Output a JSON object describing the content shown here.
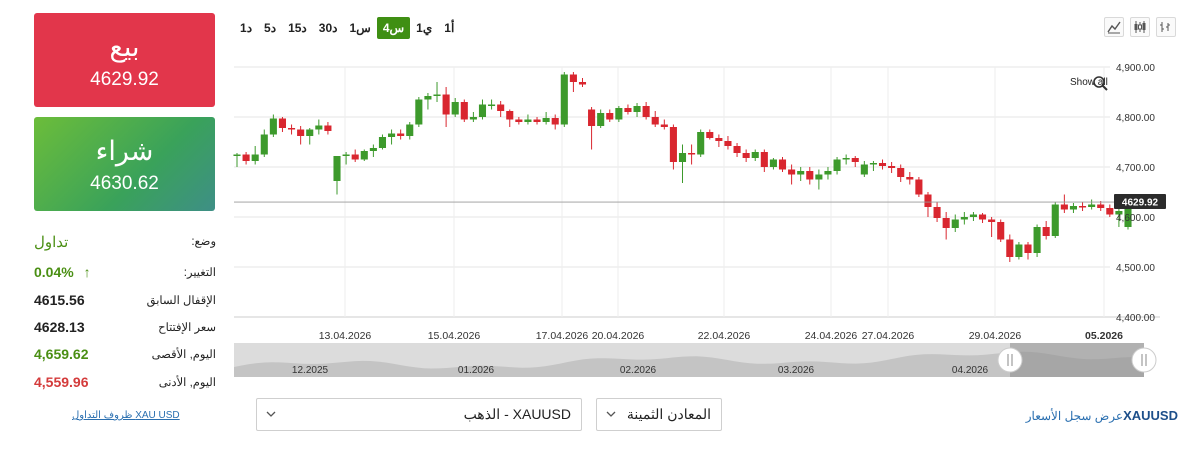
{
  "sell": {
    "label": "بيع",
    "price": "4629.92"
  },
  "buy": {
    "label": "شراء",
    "price": "4630.62"
  },
  "info": {
    "status_label": "وضع:",
    "status_value": "تداول",
    "change_label": "التغيير:",
    "change_value": "0.04%",
    "prev_close_label": "الإقفال السابق",
    "prev_close_value": "4615.56",
    "open_label": "سعر الإفتتاح",
    "open_value": "4628.13",
    "high_label": "اليوم, الأقصى",
    "high_value": "4,659.62",
    "low_label": "اليوم, الأدنى",
    "low_value": "4,559.96"
  },
  "terms_link": "XAU USD ظروف التداول",
  "timeframes": [
    "1أ",
    "1ي",
    "4س",
    "1س",
    "30د",
    "15د",
    "5د",
    "1د"
  ],
  "active_timeframe": "4س",
  "chart_tools": [
    "line-chart-icon",
    "candlestick-icon",
    "bar-chart-icon"
  ],
  "show_all_label": "Show all",
  "current_price_tag": "4629.92",
  "chart_data": {
    "type": "candlestick",
    "y_ticks": [
      "4,900.00",
      "4,800.00",
      "4,700.00",
      "4,600.00",
      "4,500.00",
      "4,400.00"
    ],
    "ylim": [
      4400,
      4900
    ],
    "x_ticks": [
      "13.04.2026",
      "15.04.2026",
      "17.04.2026",
      "20.04.2026",
      "22.04.2026",
      "24.04.2026",
      "27.04.2026",
      "29.04.2026",
      "05.2026"
    ],
    "navigator_ticks": [
      "12.2025",
      "01.2026",
      "02.2026",
      "03.2026",
      "04.2026"
    ],
    "colors": {
      "up": "#3d9a2c",
      "down": "#d9262f"
    },
    "candles": [
      {
        "o": 4722,
        "h": 4728,
        "l": 4700,
        "c": 4725
      },
      {
        "o": 4725,
        "h": 4730,
        "l": 4705,
        "c": 4712
      },
      {
        "o": 4712,
        "h": 4742,
        "l": 4705,
        "c": 4725
      },
      {
        "o": 4725,
        "h": 4775,
        "l": 4720,
        "c": 4765
      },
      {
        "o": 4765,
        "h": 4805,
        "l": 4760,
        "c": 4797
      },
      {
        "o": 4797,
        "h": 4800,
        "l": 4770,
        "c": 4778
      },
      {
        "o": 4778,
        "h": 4785,
        "l": 4765,
        "c": 4775
      },
      {
        "o": 4775,
        "h": 4782,
        "l": 4745,
        "c": 4762
      },
      {
        "o": 4762,
        "h": 4778,
        "l": 4745,
        "c": 4775
      },
      {
        "o": 4775,
        "h": 4795,
        "l": 4765,
        "c": 4783
      },
      {
        "o": 4783,
        "h": 4790,
        "l": 4765,
        "c": 4772
      },
      {
        "o": 4672,
        "h": 4700,
        "l": 4645,
        "c": 4722
      },
      {
        "o": 4722,
        "h": 4730,
        "l": 4705,
        "c": 4725
      },
      {
        "o": 4725,
        "h": 4735,
        "l": 4710,
        "c": 4715
      },
      {
        "o": 4715,
        "h": 4735,
        "l": 4712,
        "c": 4732
      },
      {
        "o": 4732,
        "h": 4745,
        "l": 4720,
        "c": 4738
      },
      {
        "o": 4738,
        "h": 4765,
        "l": 4735,
        "c": 4760
      },
      {
        "o": 4760,
        "h": 4775,
        "l": 4745,
        "c": 4767
      },
      {
        "o": 4767,
        "h": 4775,
        "l": 4755,
        "c": 4762
      },
      {
        "o": 4762,
        "h": 4790,
        "l": 4755,
        "c": 4785
      },
      {
        "o": 4785,
        "h": 4840,
        "l": 4780,
        "c": 4835
      },
      {
        "o": 4835,
        "h": 4848,
        "l": 4815,
        "c": 4842
      },
      {
        "o": 4842,
        "h": 4870,
        "l": 4830,
        "c": 4845
      },
      {
        "o": 4845,
        "h": 4860,
        "l": 4780,
        "c": 4805
      },
      {
        "o": 4805,
        "h": 4838,
        "l": 4800,
        "c": 4830
      },
      {
        "o": 4830,
        "h": 4835,
        "l": 4790,
        "c": 4795
      },
      {
        "o": 4795,
        "h": 4810,
        "l": 4790,
        "c": 4800
      },
      {
        "o": 4800,
        "h": 4835,
        "l": 4795,
        "c": 4825
      },
      {
        "o": 4825,
        "h": 4835,
        "l": 4815,
        "c": 4825
      },
      {
        "o": 4825,
        "h": 4832,
        "l": 4800,
        "c": 4812
      },
      {
        "o": 4812,
        "h": 4815,
        "l": 4780,
        "c": 4795
      },
      {
        "o": 4795,
        "h": 4800,
        "l": 4785,
        "c": 4790
      },
      {
        "o": 4790,
        "h": 4805,
        "l": 4785,
        "c": 4795
      },
      {
        "o": 4795,
        "h": 4800,
        "l": 4785,
        "c": 4790
      },
      {
        "o": 4790,
        "h": 4810,
        "l": 4785,
        "c": 4798
      },
      {
        "o": 4798,
        "h": 4805,
        "l": 4775,
        "c": 4785
      },
      {
        "o": 4785,
        "h": 4890,
        "l": 4780,
        "c": 4885
      },
      {
        "o": 4885,
        "h": 4890,
        "l": 4850,
        "c": 4870
      },
      {
        "o": 4870,
        "h": 4878,
        "l": 4860,
        "c": 4865
      },
      {
        "o": 4815,
        "h": 4820,
        "l": 4735,
        "c": 4782
      },
      {
        "o": 4782,
        "h": 4815,
        "l": 4778,
        "c": 4808
      },
      {
        "o": 4808,
        "h": 4815,
        "l": 4790,
        "c": 4795
      },
      {
        "o": 4795,
        "h": 4822,
        "l": 4790,
        "c": 4818
      },
      {
        "o": 4818,
        "h": 4825,
        "l": 4805,
        "c": 4810
      },
      {
        "o": 4810,
        "h": 4828,
        "l": 4800,
        "c": 4822
      },
      {
        "o": 4822,
        "h": 4830,
        "l": 4795,
        "c": 4800
      },
      {
        "o": 4800,
        "h": 4812,
        "l": 4780,
        "c": 4785
      },
      {
        "o": 4785,
        "h": 4795,
        "l": 4775,
        "c": 4780
      },
      {
        "o": 4780,
        "h": 4785,
        "l": 4695,
        "c": 4710
      },
      {
        "o": 4710,
        "h": 4745,
        "l": 4668,
        "c": 4728
      },
      {
        "o": 4728,
        "h": 4745,
        "l": 4705,
        "c": 4725
      },
      {
        "o": 4725,
        "h": 4775,
        "l": 4720,
        "c": 4770
      },
      {
        "o": 4770,
        "h": 4775,
        "l": 4755,
        "c": 4758
      },
      {
        "o": 4758,
        "h": 4765,
        "l": 4740,
        "c": 4752
      },
      {
        "o": 4752,
        "h": 4762,
        "l": 4735,
        "c": 4742
      },
      {
        "o": 4742,
        "h": 4748,
        "l": 4720,
        "c": 4728
      },
      {
        "o": 4728,
        "h": 4735,
        "l": 4710,
        "c": 4718
      },
      {
        "o": 4718,
        "h": 4735,
        "l": 4712,
        "c": 4730
      },
      {
        "o": 4730,
        "h": 4735,
        "l": 4690,
        "c": 4700
      },
      {
        "o": 4700,
        "h": 4718,
        "l": 4695,
        "c": 4715
      },
      {
        "o": 4715,
        "h": 4720,
        "l": 4690,
        "c": 4695
      },
      {
        "o": 4695,
        "h": 4705,
        "l": 4665,
        "c": 4685
      },
      {
        "o": 4685,
        "h": 4700,
        "l": 4672,
        "c": 4692
      },
      {
        "o": 4692,
        "h": 4700,
        "l": 4665,
        "c": 4675
      },
      {
        "o": 4675,
        "h": 4695,
        "l": 4655,
        "c": 4685
      },
      {
        "o": 4685,
        "h": 4700,
        "l": 4675,
        "c": 4692
      },
      {
        "o": 4692,
        "h": 4720,
        "l": 4685,
        "c": 4715
      },
      {
        "o": 4715,
        "h": 4725,
        "l": 4705,
        "c": 4718
      },
      {
        "o": 4718,
        "h": 4722,
        "l": 4700,
        "c": 4710
      },
      {
        "o": 4685,
        "h": 4712,
        "l": 4680,
        "c": 4705
      },
      {
        "o": 4705,
        "h": 4712,
        "l": 4692,
        "c": 4708
      },
      {
        "o": 4708,
        "h": 4715,
        "l": 4695,
        "c": 4702
      },
      {
        "o": 4702,
        "h": 4710,
        "l": 4688,
        "c": 4698
      },
      {
        "o": 4698,
        "h": 4705,
        "l": 4670,
        "c": 4680
      },
      {
        "o": 4680,
        "h": 4690,
        "l": 4665,
        "c": 4675
      },
      {
        "o": 4675,
        "h": 4680,
        "l": 4640,
        "c": 4645
      },
      {
        "o": 4645,
        "h": 4650,
        "l": 4600,
        "c": 4620
      },
      {
        "o": 4620,
        "h": 4630,
        "l": 4590,
        "c": 4598
      },
      {
        "o": 4598,
        "h": 4610,
        "l": 4555,
        "c": 4578
      },
      {
        "o": 4578,
        "h": 4605,
        "l": 4570,
        "c": 4595
      },
      {
        "o": 4595,
        "h": 4610,
        "l": 4585,
        "c": 4600
      },
      {
        "o": 4600,
        "h": 4610,
        "l": 4592,
        "c": 4605
      },
      {
        "o": 4605,
        "h": 4608,
        "l": 4588,
        "c": 4595
      },
      {
        "o": 4595,
        "h": 4600,
        "l": 4560,
        "c": 4590
      },
      {
        "o": 4590,
        "h": 4595,
        "l": 4550,
        "c": 4555
      },
      {
        "o": 4555,
        "h": 4565,
        "l": 4510,
        "c": 4520
      },
      {
        "o": 4520,
        "h": 4550,
        "l": 4515,
        "c": 4545
      },
      {
        "o": 4545,
        "h": 4550,
        "l": 4515,
        "c": 4528
      },
      {
        "o": 4528,
        "h": 4585,
        "l": 4520,
        "c": 4580
      },
      {
        "o": 4580,
        "h": 4592,
        "l": 4555,
        "c": 4562
      },
      {
        "o": 4562,
        "h": 4630,
        "l": 4558,
        "c": 4625
      },
      {
        "o": 4625,
        "h": 4645,
        "l": 4608,
        "c": 4615
      },
      {
        "o": 4615,
        "h": 4628,
        "l": 4608,
        "c": 4622
      },
      {
        "o": 4622,
        "h": 4630,
        "l": 4612,
        "c": 4620
      },
      {
        "o": 4620,
        "h": 4635,
        "l": 4615,
        "c": 4625
      },
      {
        "o": 4625,
        "h": 4632,
        "l": 4612,
        "c": 4618
      },
      {
        "o": 4618,
        "h": 4625,
        "l": 4600,
        "c": 4605
      },
      {
        "o": 4605,
        "h": 4625,
        "l": 4580,
        "c": 4612
      },
      {
        "o": 4580,
        "h": 4635,
        "l": 4575,
        "c": 4630
      }
    ]
  },
  "symbol_select": "XAUUSD - الذهب",
  "category_select": "المعادن الثمينة",
  "history_link": {
    "symbol": "XAUUSD",
    "text": "عرض سجل الأسعار"
  }
}
